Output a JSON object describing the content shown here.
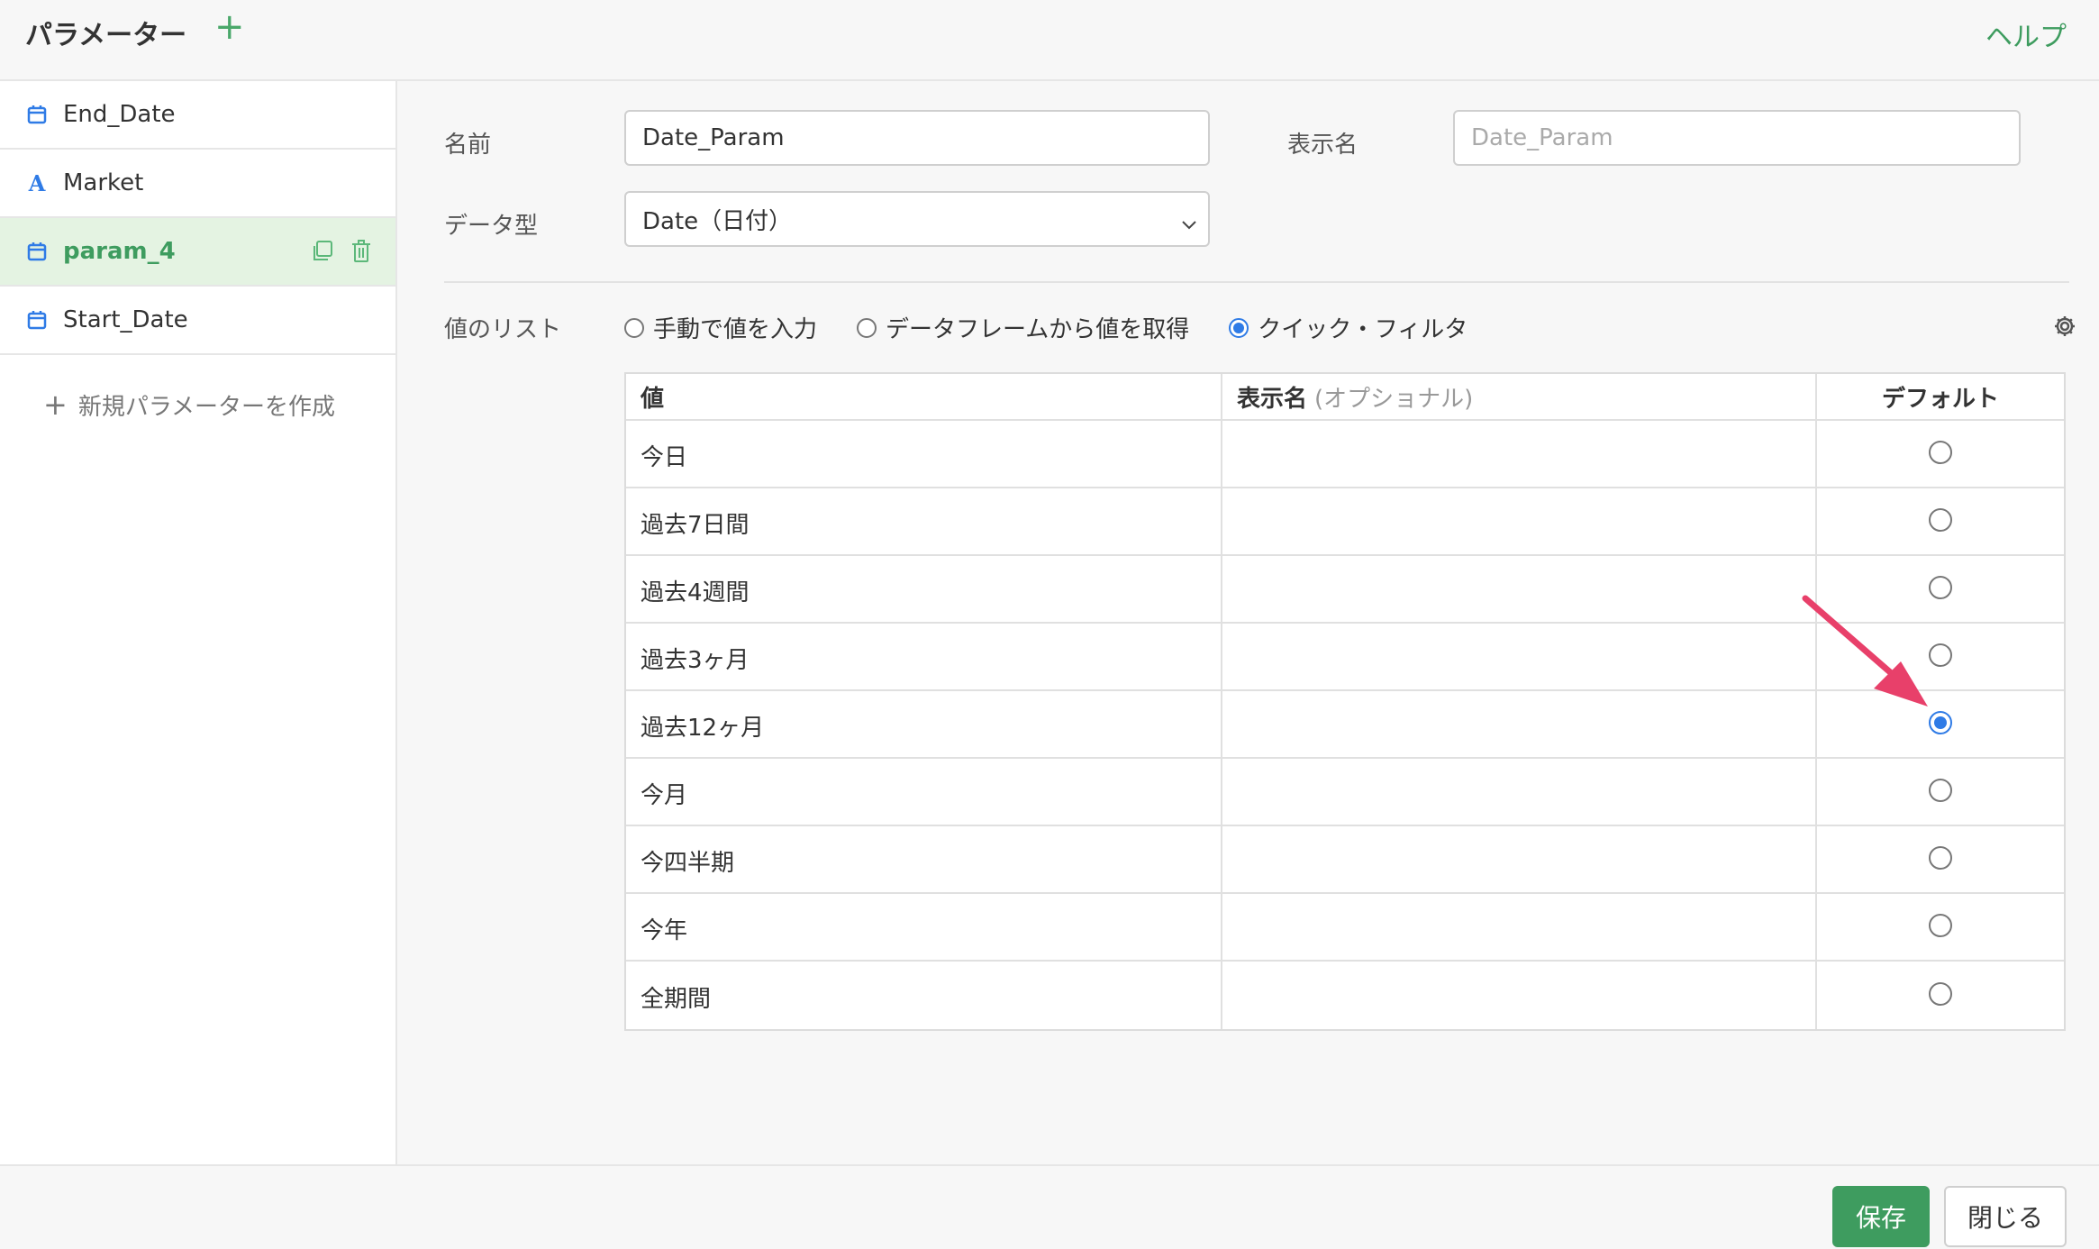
{
  "header": {
    "title": "パラメーター",
    "add_icon": "+",
    "help": "ヘルプ"
  },
  "sidebar": {
    "items": [
      {
        "label": "End_Date",
        "icon": "calendar-icon"
      },
      {
        "label": "Market",
        "icon": "text-icon"
      },
      {
        "label": "param_4",
        "icon": "calendar-icon",
        "active": true
      },
      {
        "label": "Start_Date",
        "icon": "calendar-icon"
      }
    ],
    "new_param": "新規パラメーターを作成"
  },
  "form": {
    "name_label": "名前",
    "name_value": "Date_Param",
    "display_label": "表示名",
    "display_placeholder": "Date_Param",
    "type_label": "データ型",
    "type_value": "Date（日付）",
    "list_label": "値のリスト",
    "list_options": [
      "手動で値を入力",
      "データフレームから値を取得",
      "クイック・フィルタ"
    ],
    "list_selected": 2
  },
  "table": {
    "headers": {
      "value": "値",
      "display": "表示名",
      "display_optional": "(オプショナル)",
      "default": "デフォルト"
    },
    "rows": [
      "今日",
      "過去7日間",
      "過去4週間",
      "過去3ヶ月",
      "過去12ヶ月",
      "今月",
      "今四半期",
      "今年",
      "全期間"
    ],
    "default_index": 4
  },
  "footer": {
    "save": "保存",
    "close": "閉じる"
  },
  "colors": {
    "accent": "#3e9c5f",
    "radio": "#2f7be6",
    "arrow": "#e8406a"
  }
}
